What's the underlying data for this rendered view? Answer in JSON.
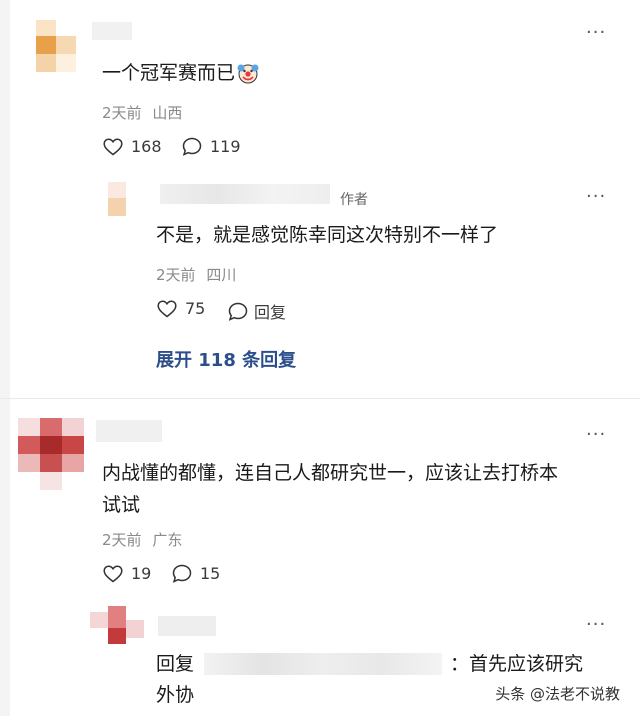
{
  "comments": [
    {
      "text": "一个冠军赛而已",
      "emoji": "clown-face",
      "time": "2天前",
      "location": "山西",
      "likes": "168",
      "replies": "119",
      "reply": {
        "author_tag": "作者",
        "text": "不是，就是感觉陈幸同这次特别不一样了",
        "time": "2天前",
        "location": "四川",
        "likes": "75",
        "reply_label": "回复"
      },
      "expand_label": "展开 118 条回复"
    },
    {
      "text_line1": "内战懂的都懂，连自己人都研究世一，应该让去打桥本",
      "text_line2": "试试",
      "time": "2天前",
      "location": "广东",
      "likes": "19",
      "replies": "15",
      "reply": {
        "prefix": "回复",
        "text_suffix": "：首先应该研究",
        "text_line2": "外协"
      }
    }
  ],
  "more_icon": "more-dots-icon",
  "watermark": {
    "text": "头条 @法老不说教"
  },
  "colors": {
    "link": "#2c4f8c",
    "meta": "#8a8a8a"
  }
}
